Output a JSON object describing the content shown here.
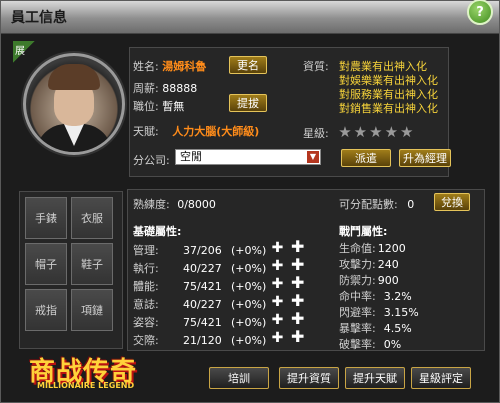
{
  "window": {
    "title": "員工信息"
  },
  "help": {
    "label": "?"
  },
  "profile": {
    "corner_tag": "展",
    "name_label": "姓名:",
    "name_value": "湯姆科魯",
    "salary_label": "周薪:",
    "salary_value": "88888",
    "position_label": "職位:",
    "position_value": "暫無",
    "talent_label": "天賦:",
    "talent_value": "人力大腦(大師級)",
    "branch_label": "分公司:",
    "branch_value": "空閒",
    "rename_button": "更名",
    "promote_button": "提拔",
    "dispatch_button": "派遣",
    "manager_button": "升為經理"
  },
  "qualifications": {
    "label": "資質:",
    "items": [
      "對農業有出神入化",
      "對娛樂業有出神入化",
      "對服務業有出神入化",
      "對銷售業有出神入化"
    ]
  },
  "stars": {
    "label": "星級:",
    "count": 5,
    "filled": 0
  },
  "equipment": {
    "slots": [
      "手錶",
      "衣服",
      "帽子",
      "鞋子",
      "戒指",
      "項鏈"
    ]
  },
  "stats": {
    "proficiency_label": "熟練度:",
    "proficiency_value": "0/8000",
    "points_label": "可分配點數:",
    "points_value": "0",
    "exchange_button": "兌換",
    "basic_title": "基礎屬性:",
    "basic": [
      {
        "name": "管理:",
        "value": "37/206",
        "bonus": "(+0%)"
      },
      {
        "name": "執行:",
        "value": "40/227",
        "bonus": "(+0%)"
      },
      {
        "name": "體能:",
        "value": "75/421",
        "bonus": "(+0%)"
      },
      {
        "name": "意誌:",
        "value": "40/227",
        "bonus": "(+0%)"
      },
      {
        "name": "姿容:",
        "value": "75/421",
        "bonus": "(+0%)"
      },
      {
        "name": "交際:",
        "value": "21/120",
        "bonus": "(+0%)"
      }
    ],
    "battle_title": "戰鬥屬性:",
    "battle": [
      {
        "name": "生命值:",
        "value": "1200"
      },
      {
        "name": "攻擊力:",
        "value": "240"
      },
      {
        "name": "防禦力:",
        "value": "900"
      },
      {
        "name": "命中率:",
        "value": "3.2%"
      },
      {
        "name": "閃避率:",
        "value": "3.15%"
      },
      {
        "name": "暴擊率:",
        "value": "4.5%"
      },
      {
        "name": "破擊率:",
        "value": "0%"
      }
    ]
  },
  "logo": {
    "title": "商战传奇",
    "subtitle": "MILLIONAIRE LEGEND"
  },
  "bottom_buttons": [
    "培訓",
    "提升資質",
    "提升天賦",
    "星級評定"
  ]
}
